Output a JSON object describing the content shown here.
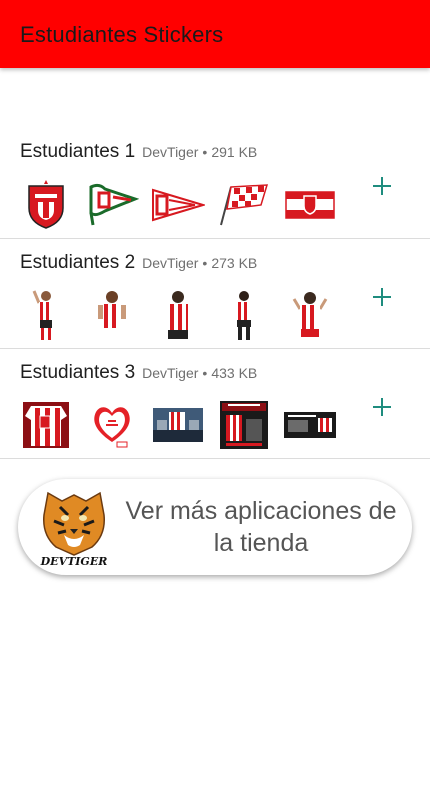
{
  "appbar": {
    "title": "Estudiantes Stickers",
    "color": "#ff0000"
  },
  "packs": [
    {
      "name": "Estudiantes 1",
      "author": "DevTiger",
      "separator": "•",
      "size": "291 KB",
      "stickers": [
        "club-crest-sticker",
        "club-flag-sticker",
        "pennant-sticker",
        "checkered-flag-sticker",
        "banner-sticker"
      ]
    },
    {
      "name": "Estudiantes 2",
      "author": "DevTiger",
      "separator": "•",
      "size": "273 KB",
      "stickers": [
        "player-sticker",
        "player-sticker",
        "player-sticker",
        "player-sticker",
        "player-sticker"
      ]
    },
    {
      "name": "Estudiantes 3",
      "author": "DevTiger",
      "separator": "•",
      "size": "433 KB",
      "stickers": [
        "jersey-photo-sticker",
        "heart-sticker",
        "stadium-photo-sticker",
        "poster-photo-sticker",
        "text-banner-sticker"
      ]
    }
  ],
  "store_button": {
    "label": "Ver más aplicaciones de la tienda",
    "logo_text": "DEVTIGER"
  },
  "colors": {
    "accent": "#1e8c7e",
    "brand_red": "#ff0000",
    "stripe_red": "#d71920"
  }
}
